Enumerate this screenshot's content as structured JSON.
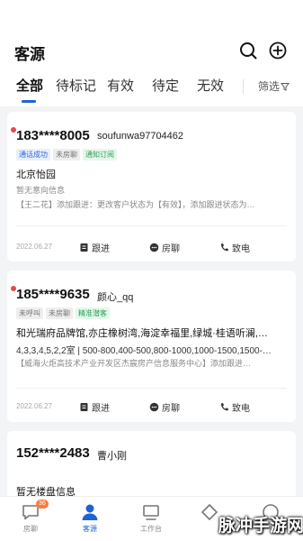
{
  "header": {
    "title": "客源",
    "search_icon": "search-icon",
    "add_icon": "plus-circle-icon"
  },
  "tabs": {
    "items": [
      {
        "label": "全部",
        "active": true
      },
      {
        "label": "待标记",
        "active": false
      },
      {
        "label": "有效",
        "active": false
      },
      {
        "label": "待定",
        "active": false
      },
      {
        "label": "无效",
        "active": false
      }
    ],
    "filter_label": "筛选",
    "accent": "#1e63d6"
  },
  "cards": [
    {
      "phone": "183****8005",
      "name": "soufunwa97704462",
      "unread": true,
      "tags": [
        {
          "label": "通话成功",
          "color": "blue"
        },
        {
          "label": "未房聊",
          "color": "gray"
        },
        {
          "label": "通知订阅",
          "color": "green"
        }
      ],
      "line1": "北京怡园",
      "line2": "暂无意向信息",
      "line3": "【王二花】添加跟进：更改客户状态为【有效】，添加跟进状态为…",
      "date": "2022.06.27",
      "actions": [
        "跟进",
        "房聊",
        "致电"
      ]
    },
    {
      "phone": "185****9635",
      "name": "颜心_qq",
      "unread": true,
      "tags": [
        {
          "label": "未呼叫",
          "color": "gray"
        },
        {
          "label": "未房聊",
          "color": "gray"
        },
        {
          "label": "精准潜客",
          "color": "green"
        }
      ],
      "line1": "和光瑞府品牌馆,亦庄橡树湾,海淀幸福里,绿城·桂语听澜,…",
      "line2": "4,3,3,4,5,2,2室 | 500-800,400-500,800-1000,1000-1500,1500-…",
      "line3": "【威海火炬高技术产业开发区杰宸房产信息服务中心】添加跟进…",
      "date": "2022.06.27",
      "actions": [
        "跟进",
        "房聊",
        "致电"
      ]
    },
    {
      "phone": "152****2483",
      "name": "曹小刚",
      "unread": false,
      "tags": [],
      "line1": "暂无楼盘信息"
    }
  ],
  "tabbar": {
    "items": [
      {
        "label": "房聊",
        "icon": "chat-icon",
        "badge": "36",
        "active": false
      },
      {
        "label": "客源",
        "icon": "person-icon",
        "active": true
      },
      {
        "label": "工作台",
        "icon": "workbench-icon",
        "active": false
      }
    ]
  },
  "watermark": "脉冲手游网"
}
